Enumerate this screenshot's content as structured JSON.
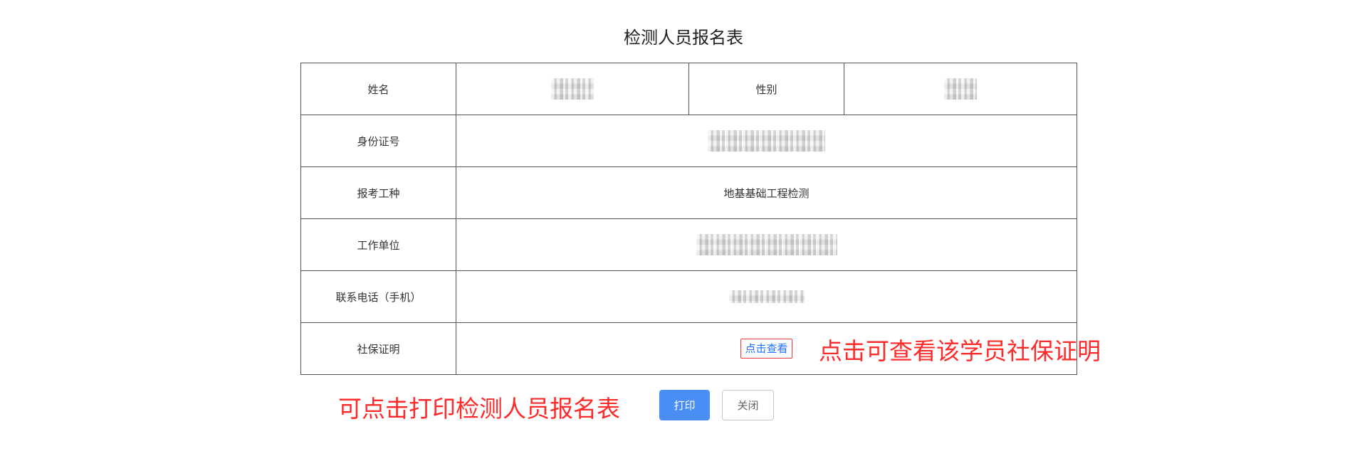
{
  "title": "检测人员报名表",
  "form": {
    "name_label": "姓名",
    "gender_label": "性别",
    "id_label": "身份证号",
    "exam_type_label": "报考工种",
    "exam_type_value": "地基基础工程检测",
    "employer_label": "工作单位",
    "phone_label": "联系电话（手机）",
    "social_security_label": "社保证明",
    "view_button_label": "点击查看"
  },
  "annotations": {
    "view_hint": "点击可查看该学员社保证明",
    "print_hint": "可点击打印检测人员报名表"
  },
  "actions": {
    "print_label": "打印",
    "close_label": "关闭"
  },
  "colors": {
    "annotation": "#ff2a2a",
    "primary": "#4a8ef5",
    "link": "#1e6fff"
  }
}
